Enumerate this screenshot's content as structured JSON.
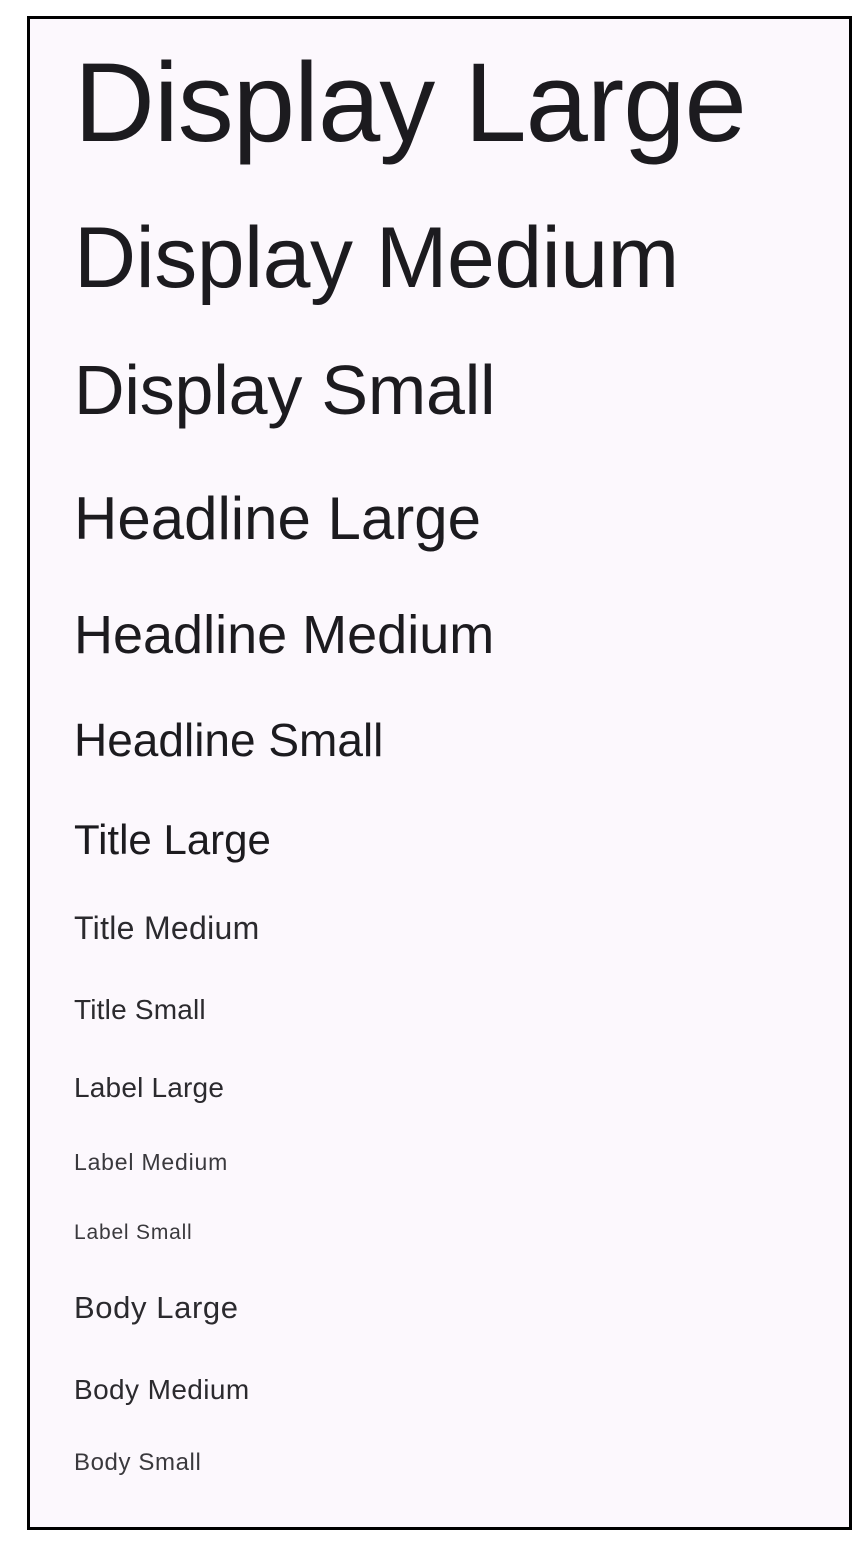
{
  "theme": {
    "background": "#fcf8fd",
    "text": "#1c1b1f",
    "border": "#000000"
  },
  "typography": {
    "display_large": "Display Large",
    "display_medium": "Display Medium",
    "display_small": "Display Small",
    "headline_large": "Headline Large",
    "headline_medium": "Headline Medium",
    "headline_small": "Headline Small",
    "title_large": "Title Large",
    "title_medium": "Title Medium",
    "title_small": "Title Small",
    "label_large": "Label Large",
    "label_medium": "Label Medium",
    "label_small": "Label Small",
    "body_large": "Body Large",
    "body_medium": "Body Medium",
    "body_small": "Body Small"
  }
}
